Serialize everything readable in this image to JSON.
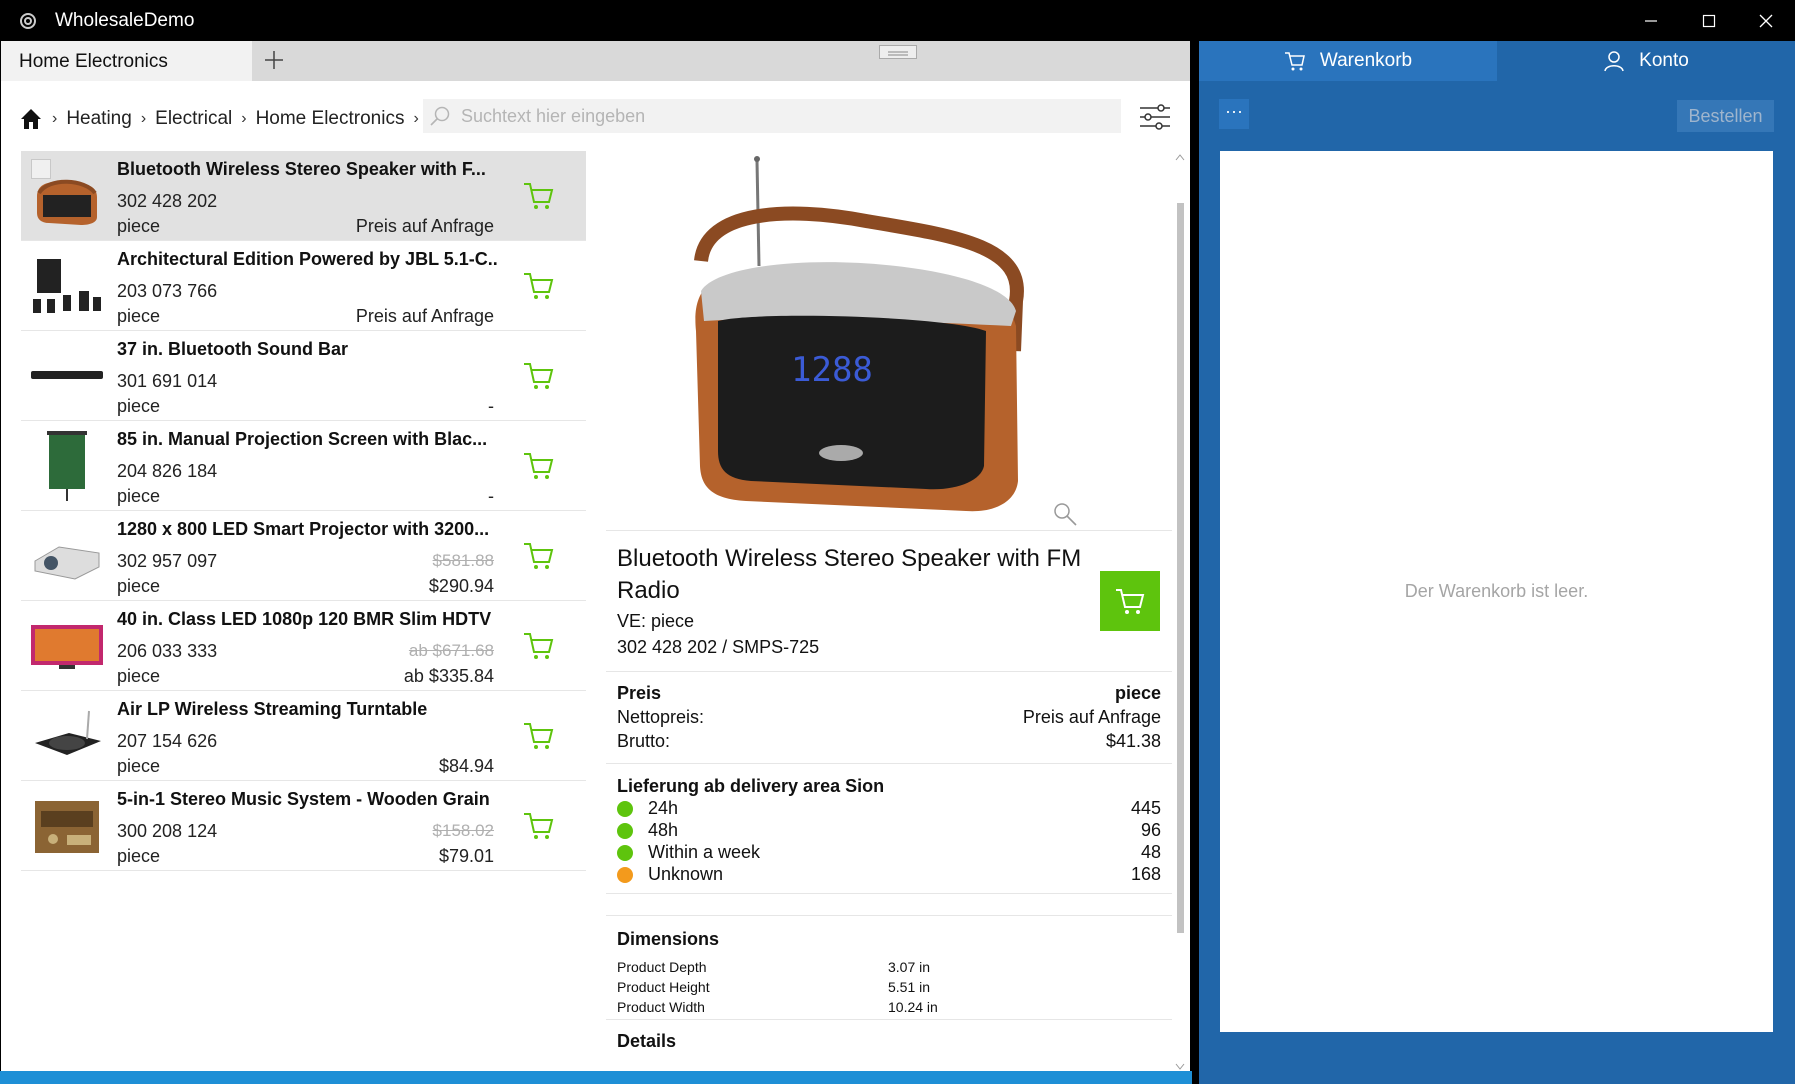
{
  "window": {
    "title": "WholesaleDemo"
  },
  "tabs": [
    {
      "label": "Home Electronics"
    }
  ],
  "breadcrumb": [
    "Heating",
    "Electrical",
    "Home Electronics"
  ],
  "search": {
    "placeholder": "Suchtext hier eingeben"
  },
  "products": [
    {
      "name": "Bluetooth Wireless Stereo Speaker with F...",
      "number": "302 428 202",
      "unit": "piece",
      "old_price": "",
      "price": "Preis auf Anfrage"
    },
    {
      "name": "Architectural Edition Powered by JBL 5.1-C...",
      "number": "203 073 766",
      "unit": "piece",
      "old_price": "",
      "price": "Preis auf Anfrage"
    },
    {
      "name": "37 in. Bluetooth Sound Bar",
      "number": "301 691 014",
      "unit": "piece",
      "old_price": "",
      "price": "-"
    },
    {
      "name": "85 in. Manual Projection Screen with Blac...",
      "number": "204 826 184",
      "unit": "piece",
      "old_price": "",
      "price": "-"
    },
    {
      "name": "1280 x 800 LED Smart Projector with 3200...",
      "number": "302 957 097",
      "unit": "piece",
      "old_price": "$581.88",
      "price": "$290.94"
    },
    {
      "name": "40 in. Class LED 1080p 120 BMR Slim HDTV",
      "number": "206 033 333",
      "unit": "piece",
      "old_price": "ab $671.68",
      "price": "ab $335.84"
    },
    {
      "name": "Air LP Wireless Streaming Turntable",
      "number": "207 154 626",
      "unit": "piece",
      "old_price": "",
      "price": "$84.94"
    },
    {
      "name": "5-in-1 Stereo Music System - Wooden Grain",
      "number": "300 208 124",
      "unit": "piece",
      "old_price": "$158.02",
      "price": "$79.01"
    }
  ],
  "detail": {
    "title": "Bluetooth Wireless Stereo Speaker with FM Radio",
    "ve": "VE: piece",
    "sku": "302 428 202 / SMPS-725",
    "price_header": "Preis",
    "price_unit": "piece",
    "net_label": "Nettopreis:",
    "net_value": "Preis auf Anfrage",
    "gross_label": "Brutto:",
    "gross_value": "$41.38",
    "delivery_title": "Lieferung ab delivery area Sion",
    "availability": [
      {
        "label": "24h",
        "qty": "445",
        "color": "#5ec40d"
      },
      {
        "label": "48h",
        "qty": "96",
        "color": "#5ec40d"
      },
      {
        "label": "Within a week",
        "qty": "48",
        "color": "#5ec40d"
      },
      {
        "label": "Unknown",
        "qty": "168",
        "color": "#f39a1c"
      }
    ],
    "dimensions_title": "Dimensions",
    "dimensions": [
      {
        "label": "Product Depth",
        "value": "3.07 in"
      },
      {
        "label": "Product Height",
        "value": "5.51 in"
      },
      {
        "label": "Product Width",
        "value": "10.24 in"
      }
    ],
    "details_title": "Details"
  },
  "right": {
    "tab_cart": "Warenkorb",
    "tab_account": "Konto",
    "more": "···",
    "order_button": "Bestellen",
    "empty_text": "Der Warenkorb ist leer."
  },
  "colors": {
    "accent_green": "#5ec40d",
    "pane_blue": "#2166a9",
    "status_blue": "#1e8fd6"
  }
}
